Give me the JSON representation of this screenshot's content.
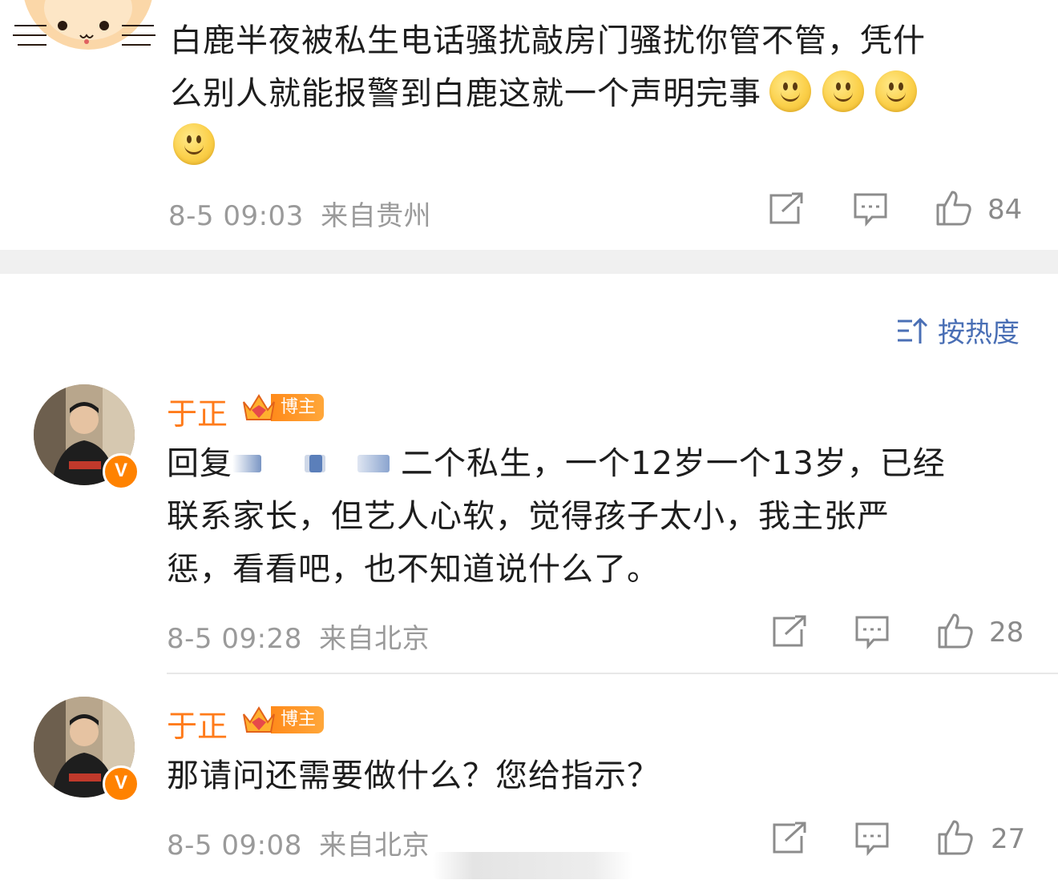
{
  "comment1": {
    "text": "白鹿半夜被私生电话骚扰敲房门骚扰你管不管，凭什么别人就能报警到白鹿这就一个声明完事",
    "line1": "白鹿半夜被私生电话骚扰敲房门骚扰你管不管，凭什",
    "line2": "么别人就能报警到白鹿这就一个声明完事",
    "timestamp": "8-5 09:03",
    "location": "来自贵州",
    "likes": "84"
  },
  "sort": {
    "label": "按热度"
  },
  "replies": [
    {
      "author": "于正",
      "badge": "博主",
      "reply_prefix": "回复",
      "line1_rest": "二个私生，一个12岁一个13岁，已经",
      "line2": "联系家长，但艺人心软，觉得孩子太小，我主张严",
      "line3": "惩，看看吧，也不知道说什么了。",
      "timestamp": "8-5 09:28",
      "location": "来自北京",
      "likes": "28"
    },
    {
      "author": "于正",
      "badge": "博主",
      "line1": "那请问还需要做什么？您给指示？",
      "timestamp": "8-5 09:08",
      "location": "来自北京",
      "likes": "27"
    }
  ],
  "colors": {
    "author": "#ff7b1a",
    "sort": "#4a6fb5",
    "meta": "#9a9a9a",
    "verified": "#ff8200"
  },
  "icons": [
    "cat-avatar-icon",
    "repost-icon",
    "comment-icon",
    "like-icon",
    "sort-icon",
    "crown-icon",
    "verified-icon"
  ]
}
